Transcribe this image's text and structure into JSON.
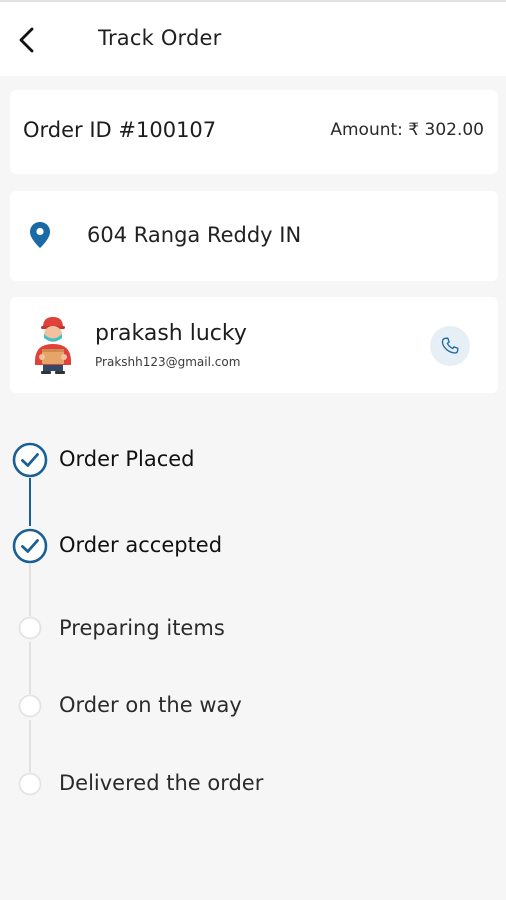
{
  "header": {
    "title": "Track Order",
    "back_icon": "chevron-left-icon"
  },
  "order": {
    "id_label": "Order ID #100107",
    "amount_label": "Amount: ₹ 302.00"
  },
  "address": {
    "icon": "map-pin-icon",
    "text": "604 Ranga Reddy IN"
  },
  "courier": {
    "name": "prakash lucky",
    "email": "Prakshh123@gmail.com",
    "call_icon": "phone-icon"
  },
  "timeline": {
    "steps": [
      {
        "label": "Order Placed",
        "status": "completed"
      },
      {
        "label": "Order accepted",
        "status": "completed"
      },
      {
        "label": "Preparing items",
        "status": "pending"
      },
      {
        "label": "Order on the way",
        "status": "pending"
      },
      {
        "label": "Delivered the order",
        "status": "pending"
      }
    ]
  },
  "colors": {
    "accent": "#1a5f95",
    "pin": "#1c6aa3",
    "call_bg": "#e7eff6",
    "inactive": "#e1e1e1",
    "background": "#f6f6f7"
  }
}
